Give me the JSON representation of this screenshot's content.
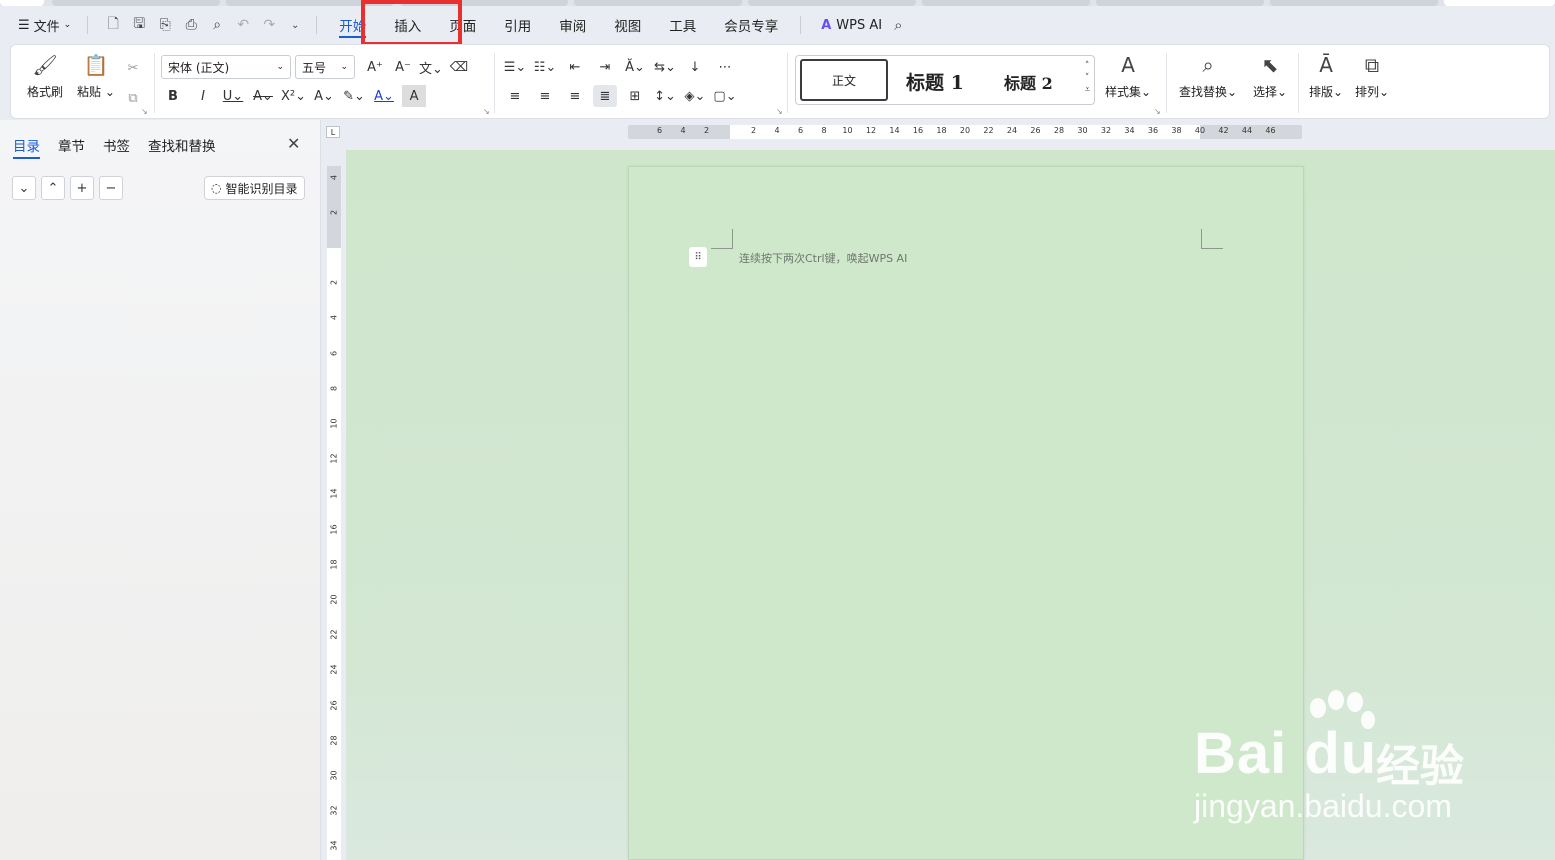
{
  "menubar": {
    "file_label": "文件",
    "tabs": [
      "开始",
      "插入",
      "页面",
      "引用",
      "审阅",
      "视图",
      "工具",
      "会员专享"
    ],
    "active_tab": "开始",
    "wps_ai_label": "WPS AI"
  },
  "ribbon": {
    "format_painter": "格式刷",
    "paste": "粘贴",
    "font_name": "宋体 (正文)",
    "font_size": "五号",
    "styles": {
      "normal": "正文",
      "heading1": "标题 1",
      "heading2": "标题 2"
    },
    "style_set": "样式集",
    "find_replace": "查找替换",
    "select": "选择",
    "layout": "排版",
    "arrange": "排列"
  },
  "leftpanel": {
    "tabs": [
      "目录",
      "章节",
      "书签",
      "查找和替换"
    ],
    "active_tab": "目录",
    "smart_toc": "智能识别目录"
  },
  "hruler_labels": [
    "6",
    "4",
    "2",
    "2",
    "4",
    "6",
    "8",
    "10",
    "12",
    "14",
    "16",
    "18",
    "20",
    "22",
    "24",
    "26",
    "28",
    "30",
    "32",
    "34",
    "36",
    "38",
    "40",
    "42",
    "44",
    "46"
  ],
  "vruler_labels": [
    "4",
    "2",
    "2",
    "4",
    "6",
    "8",
    "10",
    "12",
    "14",
    "16",
    "18",
    "20",
    "22",
    "24",
    "26",
    "28",
    "30",
    "32",
    "34"
  ],
  "document": {
    "hint": "连续按下两次Ctrl键，唤起WPS AI"
  },
  "watermark": {
    "logo": "Bai du",
    "cn": "经验",
    "url": "jingyan.baidu.com"
  },
  "colors": {
    "accent": "#1a5bd6",
    "highlight_box": "#e8312f",
    "page_bg": "#cfe8cb"
  }
}
